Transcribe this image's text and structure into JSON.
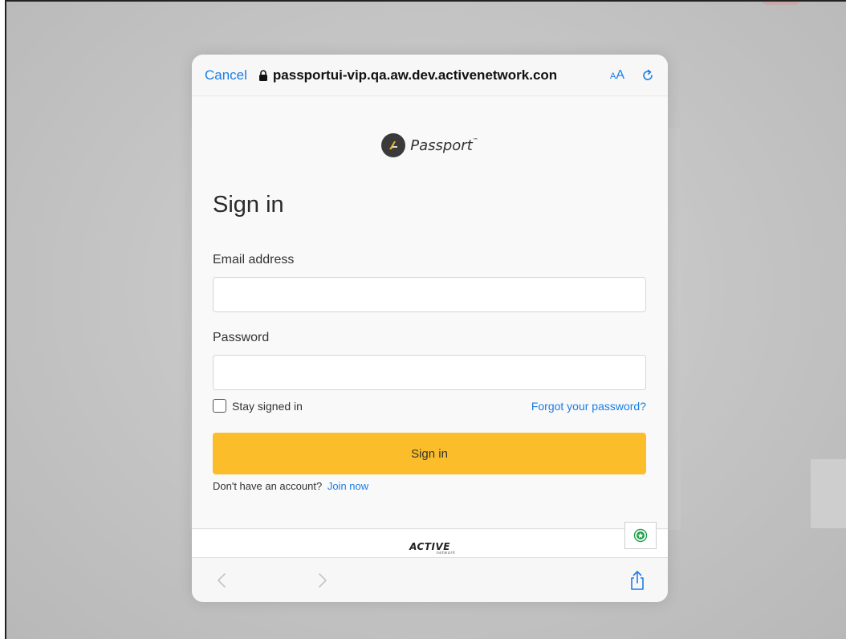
{
  "browser": {
    "cancel_label": "Cancel",
    "url": "passportui-vip.qa.aw.dev.activenetwork.con",
    "text_size_small": "A",
    "text_size_large": "A",
    "accent_color": "#1a7ee6"
  },
  "brand": {
    "name": "Passport",
    "trademark": "™"
  },
  "form": {
    "title": "Sign in",
    "email_label": "Email address",
    "email_value": "",
    "password_label": "Password",
    "password_value": "",
    "stay_signed_in_label": "Stay signed in",
    "stay_signed_in_checked": false,
    "forgot_label": "Forgot your password?",
    "submit_label": "Sign in",
    "submit_color": "#fbbd2a",
    "no_account_text": "Don't have an account?",
    "join_label": "Join now"
  },
  "footer": {
    "logo_text": "ACTIVE",
    "logo_sub": "network"
  },
  "icons": {
    "lock": "lock-icon",
    "reload": "reload-icon",
    "back": "chevron-left-icon",
    "forward": "chevron-right-icon",
    "share": "share-icon",
    "accessibility": "accessibility-icon",
    "brand": "passport-logo-icon"
  }
}
